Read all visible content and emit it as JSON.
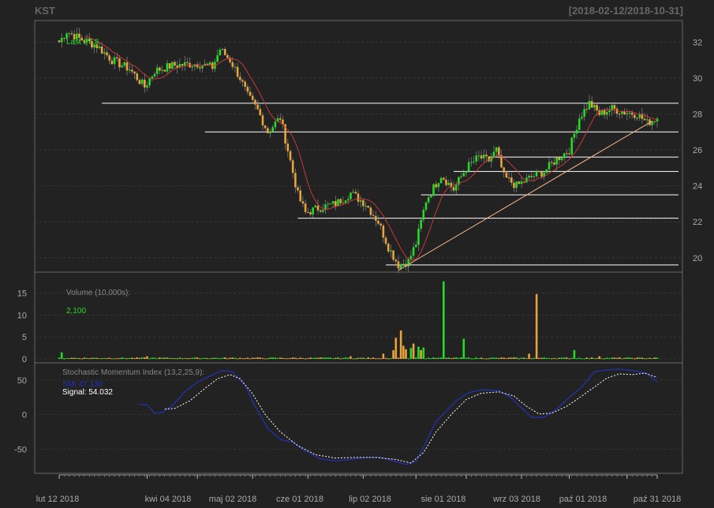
{
  "header": {
    "symbol": "KST",
    "date_range": "[2018-02-12/2018-10-31]"
  },
  "colors": {
    "background": "#222222",
    "panel_border": "#666666",
    "grid": "#444444",
    "axis_text": "#aaaaaa",
    "up_candle": "#22dd22",
    "down_candle": "#e8a33a",
    "ma_line": "#d43c3c",
    "trend_line": "#f5b78c",
    "support_line": "#ffffff",
    "smi_line": "#2233bb",
    "signal_line": "#ffffff",
    "label_green": "#22dd22"
  },
  "chart_data": [
    {
      "type": "candlestick",
      "panel": "price",
      "annotation_label": "Last 27.8",
      "ylim": [
        19.2,
        33.2
      ],
      "y_ticks": [
        20,
        22,
        24,
        26,
        28,
        30,
        32
      ],
      "x_ticks": [
        "lut 12 2018",
        "kwi 04 2018",
        "maj 02 2018",
        "cze 01 2018",
        "lip 02 2018",
        "sie 01 2018",
        "wrz 03 2018",
        "paź 01 2018",
        "paź 31 2018"
      ],
      "close_anchors": [
        {
          "day": 0,
          "close": 32.0
        },
        {
          "day": 3,
          "close": 32.6
        },
        {
          "day": 8,
          "close": 32.2
        },
        {
          "day": 15,
          "close": 31.8
        },
        {
          "day": 21,
          "close": 31.0
        },
        {
          "day": 28,
          "close": 30.5
        },
        {
          "day": 34,
          "close": 29.5
        },
        {
          "day": 38,
          "close": 30.4
        },
        {
          "day": 45,
          "close": 30.7
        },
        {
          "day": 55,
          "close": 30.8
        },
        {
          "day": 61,
          "close": 30.6
        },
        {
          "day": 64,
          "close": 31.6
        },
        {
          "day": 68,
          "close": 31.0
        },
        {
          "day": 72,
          "close": 30.0
        },
        {
          "day": 75,
          "close": 29.0
        },
        {
          "day": 79,
          "close": 28.2
        },
        {
          "day": 83,
          "close": 27.0
        },
        {
          "day": 88,
          "close": 27.8
        },
        {
          "day": 91,
          "close": 26.0
        },
        {
          "day": 95,
          "close": 23.5
        },
        {
          "day": 98,
          "close": 22.5
        },
        {
          "day": 104,
          "close": 22.8
        },
        {
          "day": 110,
          "close": 23.0
        },
        {
          "day": 116,
          "close": 23.6
        },
        {
          "day": 122,
          "close": 23.0
        },
        {
          "day": 127,
          "close": 22.0
        },
        {
          "day": 131,
          "close": 20.6
        },
        {
          "day": 135,
          "close": 19.6
        },
        {
          "day": 139,
          "close": 19.8
        },
        {
          "day": 142,
          "close": 20.8
        },
        {
          "day": 146,
          "close": 23.2
        },
        {
          "day": 152,
          "close": 24.6
        },
        {
          "day": 157,
          "close": 23.8
        },
        {
          "day": 162,
          "close": 25.0
        },
        {
          "day": 167,
          "close": 25.6
        },
        {
          "day": 171,
          "close": 25.4
        },
        {
          "day": 174,
          "close": 26.0
        },
        {
          "day": 177,
          "close": 24.5
        },
        {
          "day": 182,
          "close": 24.0
        },
        {
          "day": 188,
          "close": 24.5
        },
        {
          "day": 193,
          "close": 24.8
        },
        {
          "day": 198,
          "close": 25.5
        },
        {
          "day": 203,
          "close": 26.0
        },
        {
          "day": 207,
          "close": 27.8
        },
        {
          "day": 211,
          "close": 28.6
        },
        {
          "day": 215,
          "close": 28.0
        },
        {
          "day": 220,
          "close": 28.3
        },
        {
          "day": 225,
          "close": 28.1
        },
        {
          "day": 230,
          "close": 28.0
        },
        {
          "day": 234,
          "close": 27.5
        },
        {
          "day": 238,
          "close": 27.8
        }
      ],
      "horizontal_levels": [
        {
          "value": 28.6,
          "from_day": 17
        },
        {
          "value": 27.0,
          "from_day": 58
        },
        {
          "value": 25.6,
          "from_day": 171
        },
        {
          "value": 24.8,
          "from_day": 157
        },
        {
          "value": 23.5,
          "from_day": 144
        },
        {
          "value": 22.2,
          "from_day": 95
        },
        {
          "value": 19.6,
          "from_day": 130
        }
      ],
      "trend_line": {
        "from": {
          "day": 135,
          "value": 19.3
        },
        "to": {
          "day": 236,
          "value": 27.6
        }
      },
      "ma_period": 10
    },
    {
      "type": "bar",
      "panel": "volume",
      "legend": "Volume (10,000s):",
      "last_value_label": "2,100",
      "ylim": [
        0,
        18
      ],
      "y_ticks": [
        0,
        5,
        10,
        15
      ],
      "spikes": [
        {
          "day": 1,
          "value": 1.5,
          "up": true
        },
        {
          "day": 35,
          "value": 0.6,
          "up": false
        },
        {
          "day": 116,
          "value": 0.6,
          "up": false
        },
        {
          "day": 129,
          "value": 1.2,
          "up": false
        },
        {
          "day": 133,
          "value": 2.0,
          "up": false
        },
        {
          "day": 134,
          "value": 4.8,
          "up": false
        },
        {
          "day": 136,
          "value": 6.5,
          "up": false
        },
        {
          "day": 137,
          "value": 3.0,
          "up": false
        },
        {
          "day": 138,
          "value": 2.2,
          "up": false
        },
        {
          "day": 140,
          "value": 2.5,
          "up": true
        },
        {
          "day": 141,
          "value": 3.5,
          "up": false
        },
        {
          "day": 143,
          "value": 2.8,
          "up": true
        },
        {
          "day": 144,
          "value": 2.0,
          "up": false
        },
        {
          "day": 145,
          "value": 2.6,
          "up": true
        },
        {
          "day": 153,
          "value": 17.7,
          "up": true
        },
        {
          "day": 161,
          "value": 4.6,
          "up": true
        },
        {
          "day": 187,
          "value": 1.2,
          "up": false
        },
        {
          "day": 190,
          "value": 14.8,
          "up": false
        },
        {
          "day": 205,
          "value": 2.0,
          "up": true
        },
        {
          "day": 215,
          "value": 0.6,
          "up": false
        }
      ]
    },
    {
      "type": "line",
      "panel": "indicator",
      "legend": "Stochastic Momentum Index (13,2,25,9):",
      "series": [
        {
          "name": "SMI",
          "value_label": "47.130",
          "anchors": [
            {
              "day": 32,
              "value": 15
            },
            {
              "day": 35,
              "value": 14
            },
            {
              "day": 38,
              "value": 2
            },
            {
              "day": 41,
              "value": 3
            },
            {
              "day": 45,
              "value": 13
            },
            {
              "day": 50,
              "value": 33
            },
            {
              "day": 55,
              "value": 47
            },
            {
              "day": 60,
              "value": 56
            },
            {
              "day": 65,
              "value": 64
            },
            {
              "day": 69,
              "value": 62
            },
            {
              "day": 74,
              "value": 42
            },
            {
              "day": 78,
              "value": 12
            },
            {
              "day": 83,
              "value": -20
            },
            {
              "day": 88,
              "value": -36
            },
            {
              "day": 93,
              "value": -40
            },
            {
              "day": 98,
              "value": -53
            },
            {
              "day": 104,
              "value": -64
            },
            {
              "day": 110,
              "value": -67
            },
            {
              "day": 116,
              "value": -65
            },
            {
              "day": 122,
              "value": -62
            },
            {
              "day": 128,
              "value": -62
            },
            {
              "day": 133,
              "value": -67
            },
            {
              "day": 138,
              "value": -72
            },
            {
              "day": 142,
              "value": -68
            },
            {
              "day": 146,
              "value": -40
            },
            {
              "day": 150,
              "value": -10
            },
            {
              "day": 154,
              "value": 5
            },
            {
              "day": 158,
              "value": 20
            },
            {
              "day": 163,
              "value": 32
            },
            {
              "day": 168,
              "value": 36
            },
            {
              "day": 175,
              "value": 35
            },
            {
              "day": 180,
              "value": 24
            },
            {
              "day": 184,
              "value": 10
            },
            {
              "day": 188,
              "value": -4
            },
            {
              "day": 193,
              "value": -4
            },
            {
              "day": 198,
              "value": 8
            },
            {
              "day": 203,
              "value": 25
            },
            {
              "day": 208,
              "value": 40
            },
            {
              "day": 213,
              "value": 62
            },
            {
              "day": 218,
              "value": 65
            },
            {
              "day": 223,
              "value": 66
            },
            {
              "day": 228,
              "value": 64
            },
            {
              "day": 234,
              "value": 60
            },
            {
              "day": 238,
              "value": 47
            }
          ]
        },
        {
          "name": "Signal",
          "value_label": "54.032",
          "anchors": [
            {
              "day": 42,
              "value": 8
            },
            {
              "day": 46,
              "value": 9
            },
            {
              "day": 52,
              "value": 20
            },
            {
              "day": 58,
              "value": 38
            },
            {
              "day": 63,
              "value": 52
            },
            {
              "day": 68,
              "value": 58
            },
            {
              "day": 72,
              "value": 52
            },
            {
              "day": 77,
              "value": 30
            },
            {
              "day": 82,
              "value": 0
            },
            {
              "day": 88,
              "value": -25
            },
            {
              "day": 95,
              "value": -45
            },
            {
              "day": 102,
              "value": -58
            },
            {
              "day": 110,
              "value": -63
            },
            {
              "day": 118,
              "value": -62
            },
            {
              "day": 126,
              "value": -62
            },
            {
              "day": 134,
              "value": -65
            },
            {
              "day": 140,
              "value": -70
            },
            {
              "day": 145,
              "value": -55
            },
            {
              "day": 150,
              "value": -25
            },
            {
              "day": 156,
              "value": 0
            },
            {
              "day": 162,
              "value": 22
            },
            {
              "day": 168,
              "value": 31
            },
            {
              "day": 175,
              "value": 33
            },
            {
              "day": 181,
              "value": 27
            },
            {
              "day": 186,
              "value": 12
            },
            {
              "day": 191,
              "value": 1
            },
            {
              "day": 196,
              "value": 2
            },
            {
              "day": 202,
              "value": 12
            },
            {
              "day": 208,
              "value": 27
            },
            {
              "day": 213,
              "value": 40
            },
            {
              "day": 218,
              "value": 53
            },
            {
              "day": 223,
              "value": 59
            },
            {
              "day": 228,
              "value": 58
            },
            {
              "day": 233,
              "value": 60
            },
            {
              "day": 238,
              "value": 54
            }
          ]
        }
      ],
      "ylim": [
        -85,
        75
      ],
      "y_ticks": [
        -50,
        0,
        50
      ]
    }
  ]
}
